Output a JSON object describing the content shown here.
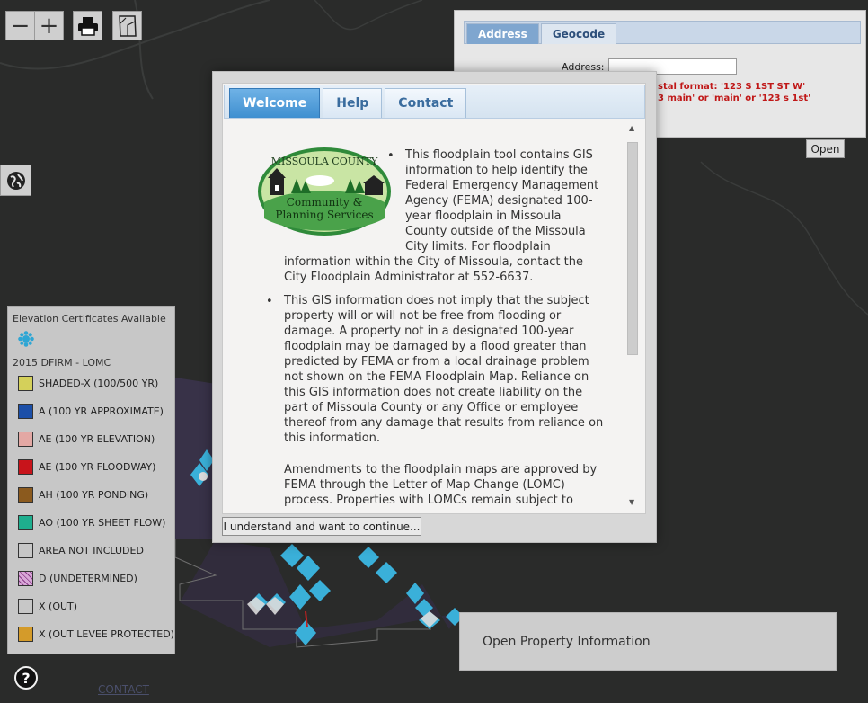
{
  "map_toolbar": {
    "zoom_out": "−",
    "zoom_in": "+",
    "print_icon": "printer-icon",
    "extent_icon": "full-extent-icon",
    "basemap_icon": "globe-icon",
    "help_icon": "question-icon"
  },
  "geocoder": {
    "tabs": [
      "Address",
      "Geocode"
    ],
    "active_tab": "Address",
    "address_label": "Address:",
    "address_value": "",
    "hints": [
      "stal format: '123 S 1ST ST W'",
      "3 main' or 'main' or '123 s 1st'"
    ],
    "open_button": "Open"
  },
  "legend": {
    "header": "Elevation Certificates Available",
    "layer_title": "2015 DFIRM - LOMC",
    "items": [
      {
        "label": "SHADED-X (100/500 YR)",
        "color": "#d4d05a"
      },
      {
        "label": "A (100 YR APPROXIMATE)",
        "color": "#1c4fa8"
      },
      {
        "label": "AE (100 YR ELEVATION)",
        "color": "#e3a8a4"
      },
      {
        "label": "AE (100 YR FLOODWAY)",
        "color": "#c8141b"
      },
      {
        "label": "AH (100 YR PONDING)",
        "color": "#8b5a1e"
      },
      {
        "label": "AO (100 YR SHEET FLOW)",
        "color": "#1eae8e"
      },
      {
        "label": "AREA NOT INCLUDED",
        "color": "#c7c7c7"
      },
      {
        "label": "D (UNDETERMINED)",
        "color": "#d9a8d8"
      },
      {
        "label": "X (OUT)",
        "color": "#c7c7c7"
      },
      {
        "label": "X (OUT LEVEE PROTECTED)",
        "color": "#d49b2a"
      }
    ]
  },
  "modal": {
    "tabs": [
      "Welcome",
      "Help",
      "Contact"
    ],
    "active_tab": "Welcome",
    "logo_text": [
      "MISSOULA COUNTY",
      "Community &",
      "Planning Services"
    ],
    "bullet1": [
      "This floodplain tool contains GIS",
      "information to help identify the",
      "Federal Emergency Management",
      "Agency (FEMA) designated 100-",
      "year floodplain in Missoula",
      "County outside of the Missoula",
      "City limits. For floodplain",
      "information within the City of Missoula, contact the",
      "City Floodplain Administrator at 552-6637."
    ],
    "bullet2": [
      "This GIS information does not imply that the subject",
      "property will or will not be free from flooding or",
      "damage. A property not in a designated 100-year",
      "floodplain may be damaged by a flood greater than",
      "predicted by FEMA or from a local drainage problem",
      "not shown on the FEMA Floodplain Map. Reliance on",
      "this GIS information does not create liability on the",
      "part of Missoula County or any Office or employee",
      "thereof from any damage that results from reliance on",
      "this information."
    ],
    "para3": [
      "Amendments to the floodplain maps are approved by",
      "FEMA through the Letter of Map Change (LOMC)",
      "process. Properties with LOMCs remain subject to"
    ],
    "continue_button": "I understand and want to continue..."
  },
  "property_info_button": "Open Property Information",
  "contact_link": "CONTACT",
  "colors": {
    "tab_active": "#3f8fd0",
    "map_bg": "#2a2b2a",
    "flood_icon": "#3ab0d9",
    "hint_red": "#c01818"
  }
}
